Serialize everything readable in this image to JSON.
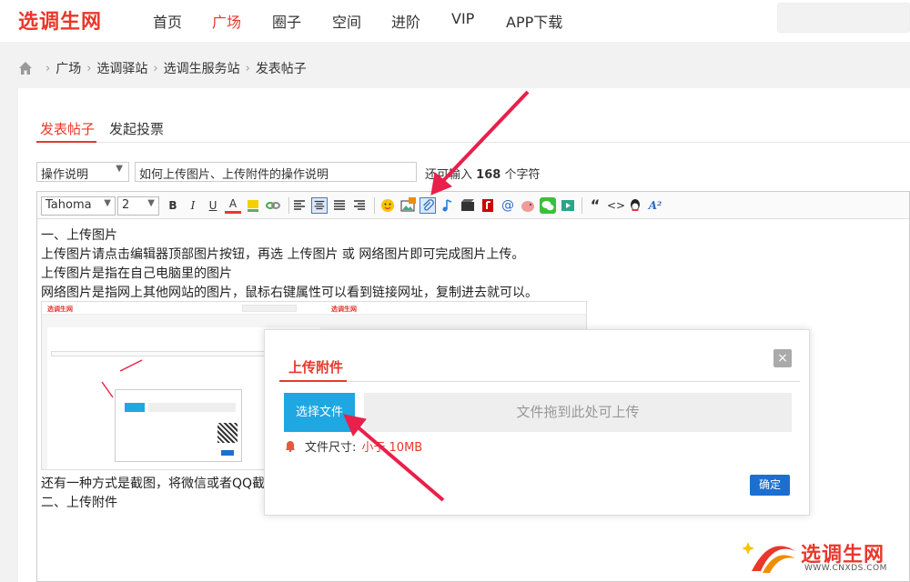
{
  "header": {
    "logo": "选调生网",
    "nav": [
      "首页",
      "广场",
      "圈子",
      "空间",
      "进阶",
      "VIP",
      "APP下载"
    ],
    "active_nav": "广场"
  },
  "breadcrumb": [
    "广场",
    "选调驿站",
    "选调生服务站",
    "发表帖子"
  ],
  "tabs": {
    "post": "发表帖子",
    "poll": "发起投票"
  },
  "form": {
    "category": "操作说明",
    "title": "如何上传图片、上传附件的操作说明",
    "remaining_prefix": "还可输入",
    "remaining_count": "168",
    "remaining_suffix": "个字符"
  },
  "toolbar": {
    "font": "Tahoma",
    "size": "2",
    "bold": "B",
    "italic": "I",
    "underline": "U",
    "font_color": "A",
    "quote": "“",
    "code": "<>"
  },
  "content": {
    "lines": [
      "一、上传图片",
      "上传图片请点击编辑器顶部图片按钮，再选 上传图片 或 网络图片即可完成图片上传。",
      "上传图片是指在自己电脑里的图片",
      "网络图片是指网上其他网站的图片，鼠标右键属性可以看到链接网址，复制进去就可以。"
    ],
    "after": [
      "还有一种方式是截图，将微信或者QQ截",
      "二、上传附件"
    ]
  },
  "thumbnail": {
    "logo_left": "选调生网",
    "logo_right": "选调生网"
  },
  "dialog": {
    "title": "上传附件",
    "close": "×",
    "choose": "选择文件",
    "drop": "文件拖到此处可上传",
    "size_label": "文件尺寸:",
    "size_value": "小于 10MB",
    "ok": "确定"
  },
  "watermark": {
    "name": "选调生网",
    "url": "WWW.CNXDS.COM"
  },
  "colors": {
    "brand_red": "#e8382b",
    "choose_blue": "#1ea7e0",
    "ok_blue": "#1a6fd1",
    "arrow": "#e8204a"
  }
}
